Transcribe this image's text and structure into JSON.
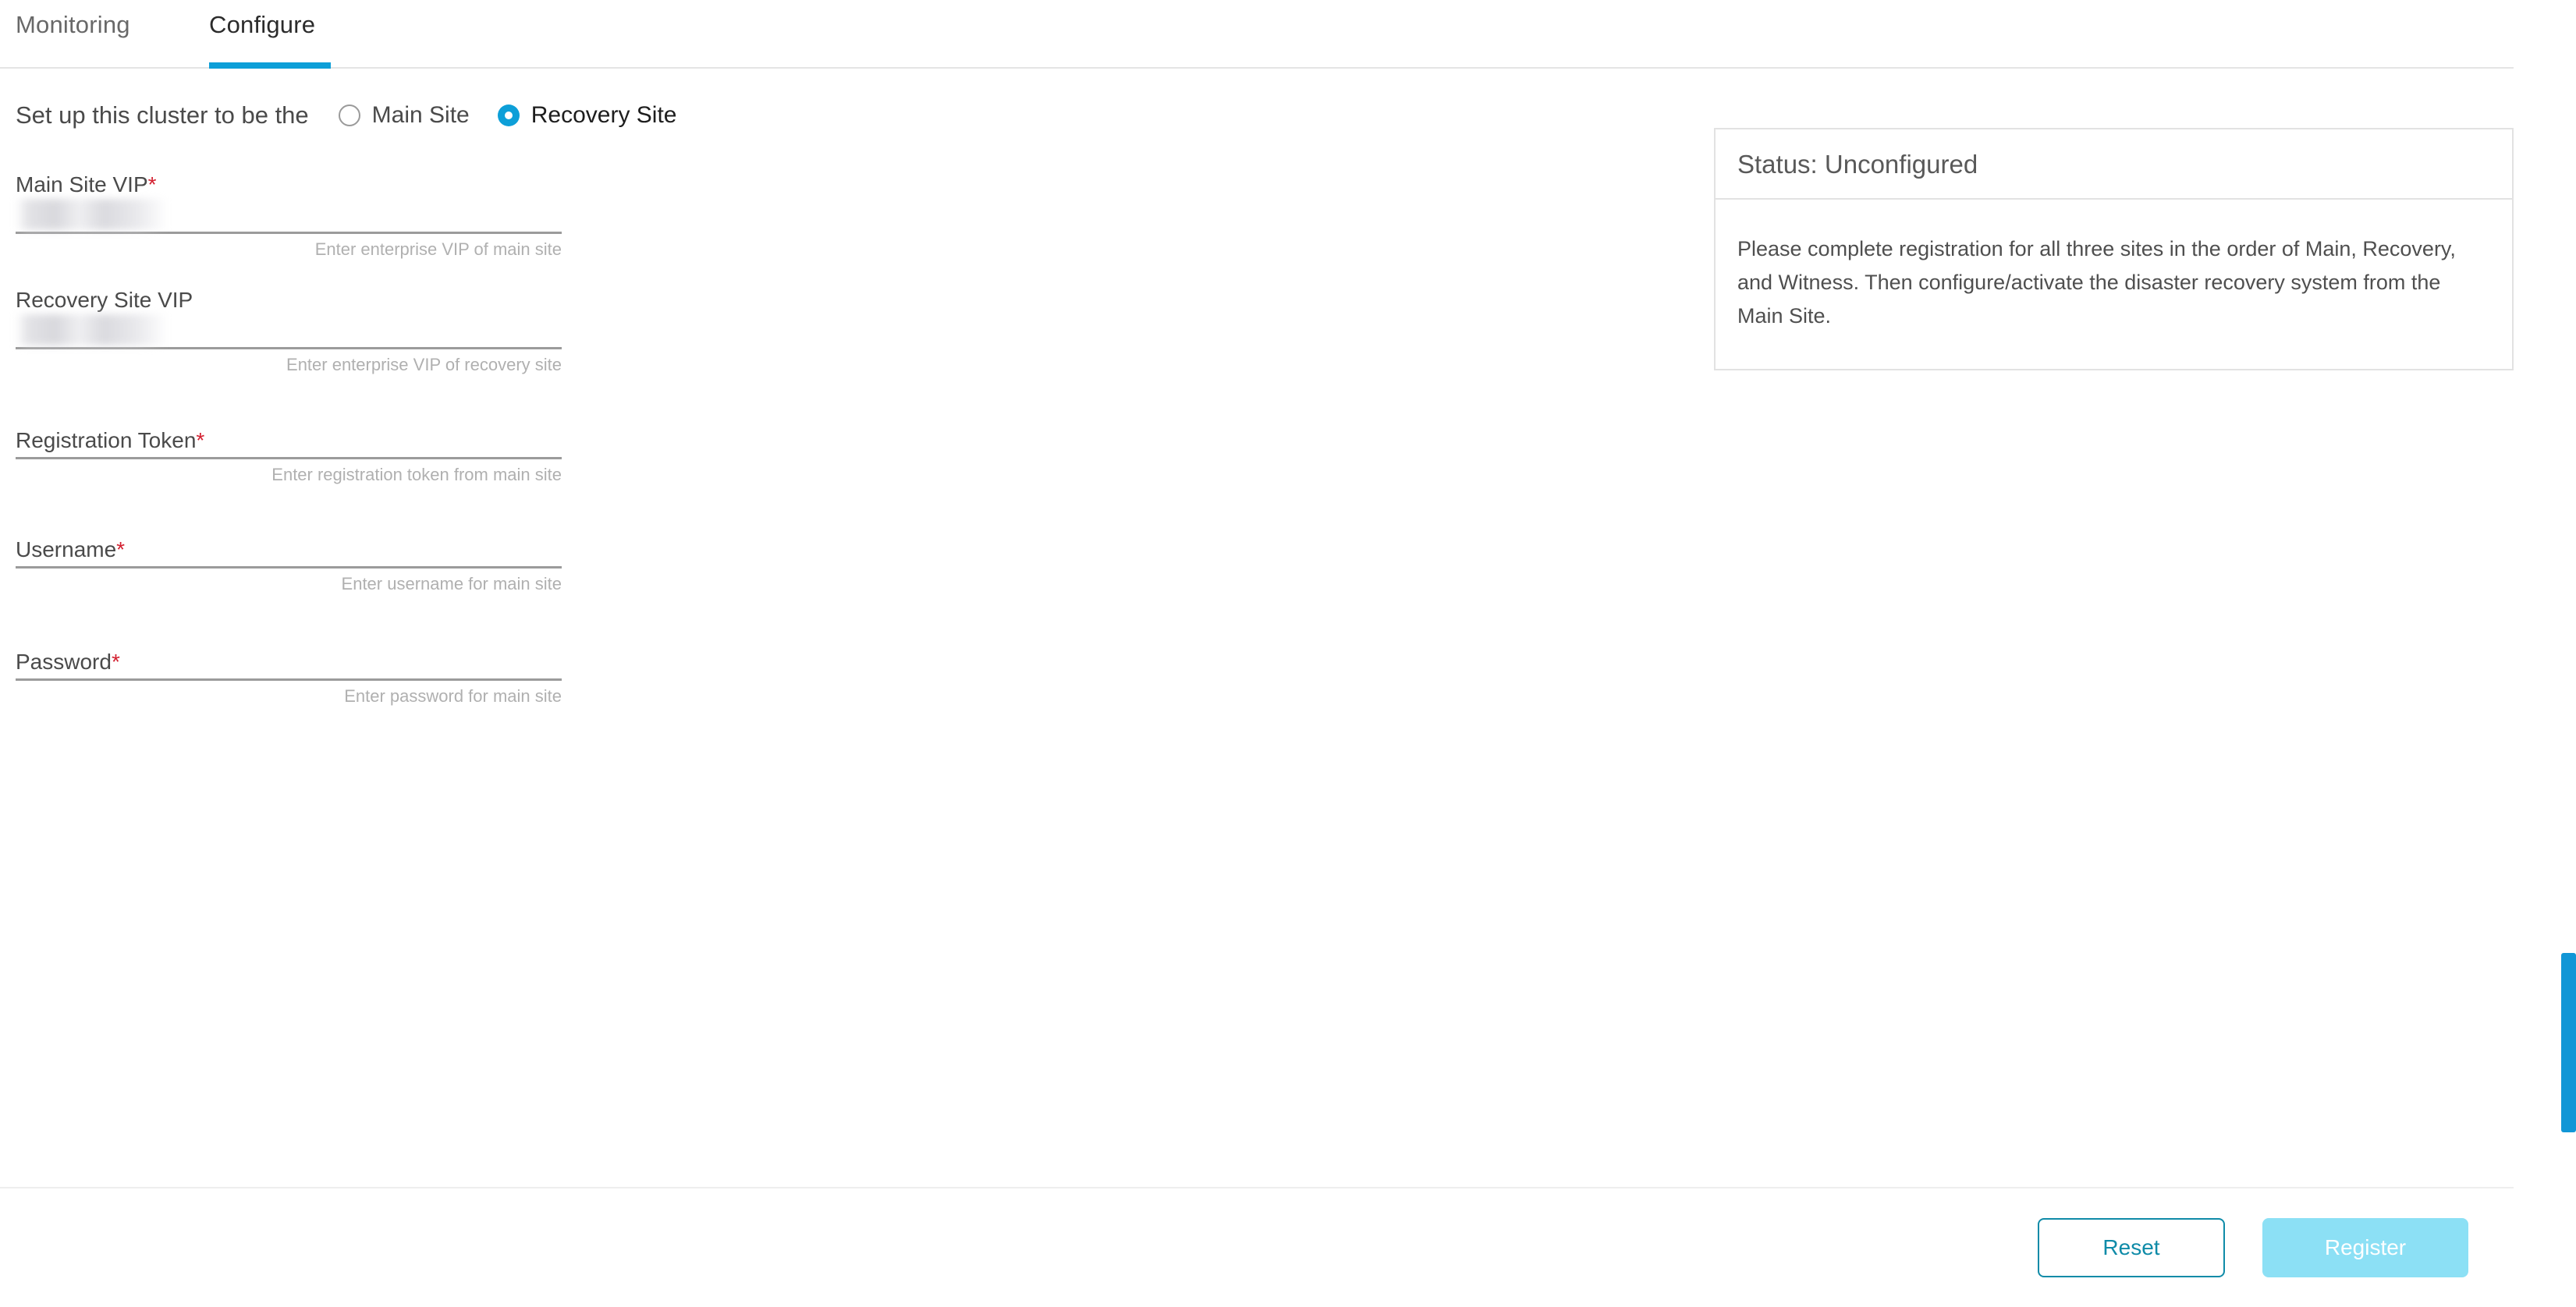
{
  "tabs": [
    {
      "label": "Monitoring",
      "active": false
    },
    {
      "label": "Configure",
      "active": true
    }
  ],
  "site_selector": {
    "intro": "Set up this cluster to be the",
    "options": [
      {
        "label": "Main Site",
        "selected": false
      },
      {
        "label": "Recovery Site",
        "selected": true
      }
    ]
  },
  "form": {
    "fields": [
      {
        "label": "Main Site VIP",
        "required": true,
        "value": "",
        "redacted": true,
        "help": "Enter enterprise VIP of main site"
      },
      {
        "label": "Recovery Site VIP",
        "required": false,
        "value": "",
        "redacted": true,
        "help": "Enter enterprise VIP of recovery site"
      },
      {
        "label": "Registration Token",
        "required": true,
        "value": "",
        "redacted": false,
        "help": "Enter registration token from main site"
      },
      {
        "label": "Username",
        "required": true,
        "value": "",
        "redacted": false,
        "help": "Enter username for main site"
      },
      {
        "label": "Password",
        "required": true,
        "value": "",
        "redacted": false,
        "help": "Enter password for main site"
      }
    ],
    "required_marker": "*"
  },
  "status_card": {
    "title": "Status: Unconfigured",
    "message": "Please complete registration for all three sites in the order of Main, Recovery, and Witness. Then configure/activate the disaster recovery system from the Main Site."
  },
  "footer": {
    "reset_label": "Reset",
    "register_label": "Register"
  },
  "colors": {
    "accent_blue": "#0d9fd8",
    "link_teal": "#0f8ba8",
    "register_disabled": "#8ce0f5",
    "required_red": "#d32030",
    "scrollbar": "#1196d6"
  }
}
